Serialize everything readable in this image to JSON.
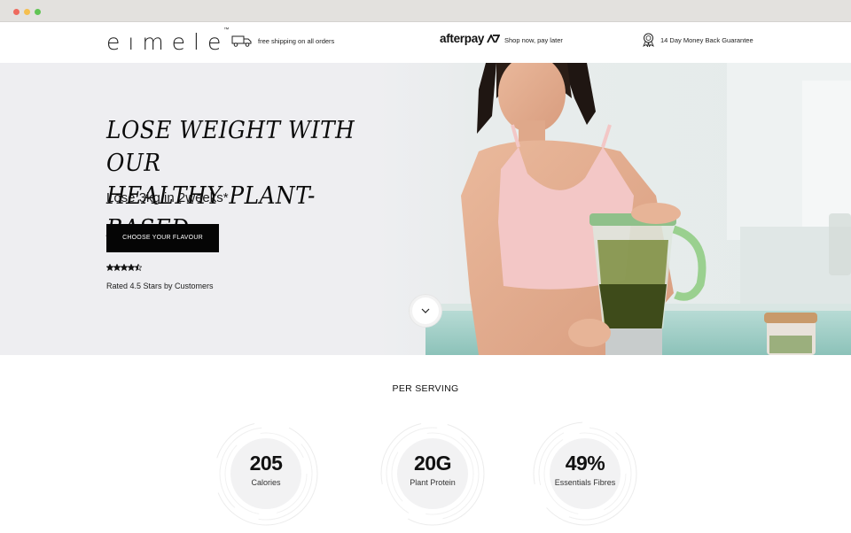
{
  "header": {
    "logo_text": "eımele",
    "logo_tm": "™",
    "shipping_text": "free shipping on all orders",
    "afterpay_logo": "afterpay",
    "afterpay_text": "Shop now, pay later",
    "guarantee_text": "14 Day Money Back Guarantee"
  },
  "hero": {
    "headline_line1": "Lose weight with our",
    "headline_line2": "healthy plant-based.",
    "subhead": "Lose 3kg in 2weeks*",
    "cta_label": "CHOOSE YOUR FLAVOUR",
    "rating_value": 4.5,
    "rating_max": 5,
    "rating_text": "Rated 4.5 Stars by Customers"
  },
  "nutrition": {
    "section_title": "PER SERVING",
    "stats": [
      {
        "value": "205",
        "label": "Calories"
      },
      {
        "value": "20G",
        "label": "Plant Protein"
      },
      {
        "value": "49%",
        "label": "Essentials Fibres"
      }
    ]
  },
  "icons": {
    "shipping": "truck-icon",
    "afterpay": "afterpay-arrows-icon",
    "guarantee": "award-badge-icon",
    "scroll": "chevron-down-icon",
    "stars": "star-icon"
  },
  "colors": {
    "cta_background": "#050505",
    "hero_background": "#eeeef1",
    "stat_disc": "#f2f2f3"
  }
}
